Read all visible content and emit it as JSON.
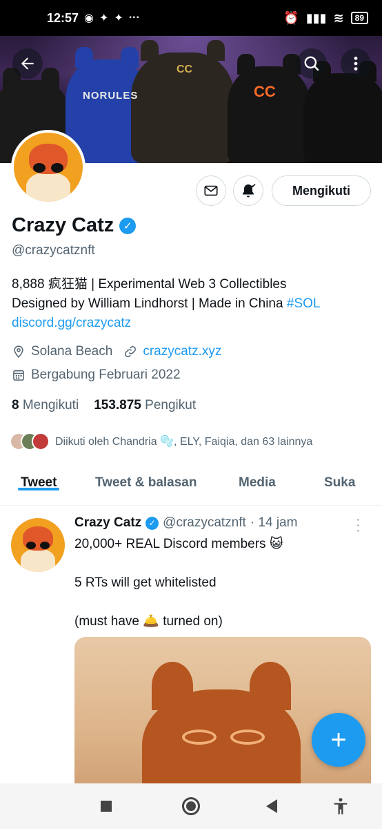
{
  "status_bar": {
    "time": "12:57",
    "notif_icons": [
      "whatsapp-icon",
      "twitter-icon",
      "twitter-icon"
    ],
    "more": "···",
    "battery": "89"
  },
  "banner": {
    "text_norules": "NORULES",
    "text_cc": "CC",
    "text_cc_small": "CC"
  },
  "profile": {
    "name": "Crazy Catz",
    "handle": "@crazycatznft",
    "bio_line1": "8,888 疯狂猫 | Experimental Web 3 Collectibles",
    "bio_line2": "Designed by William Lindhorst | Made in China",
    "bio_hashtag": "#SOL",
    "bio_link": "discord.gg/crazycatz",
    "location": "Solana Beach",
    "website": "crazycatz.xyz",
    "joined": "Bergabung Februari 2022",
    "following_count": "8",
    "following_label": "Mengikuti",
    "followers_count": "153.875",
    "followers_label": "Pengikut",
    "followed_by": "Diikuti oleh Chandria 🫧, ELY, Faiqia, dan 63 lainnya",
    "follow_button": "Mengikuti"
  },
  "tabs": [
    {
      "label": "Tweet"
    },
    {
      "label": "Tweet & balasan"
    },
    {
      "label": "Media"
    },
    {
      "label": "Suka"
    }
  ],
  "tweet": {
    "name": "Crazy Catz",
    "handle": "@crazycatznft",
    "time": "· 14 jam",
    "text": "20,000+ REAL Discord members 😺\n\n5 RTs will get whitelisted\n\n(must have 🛎️ turned on)"
  },
  "fab": {
    "label": "+"
  },
  "colors": {
    "accent": "#1d9bf0",
    "text_primary": "#0f1419",
    "text_secondary": "#536471"
  }
}
